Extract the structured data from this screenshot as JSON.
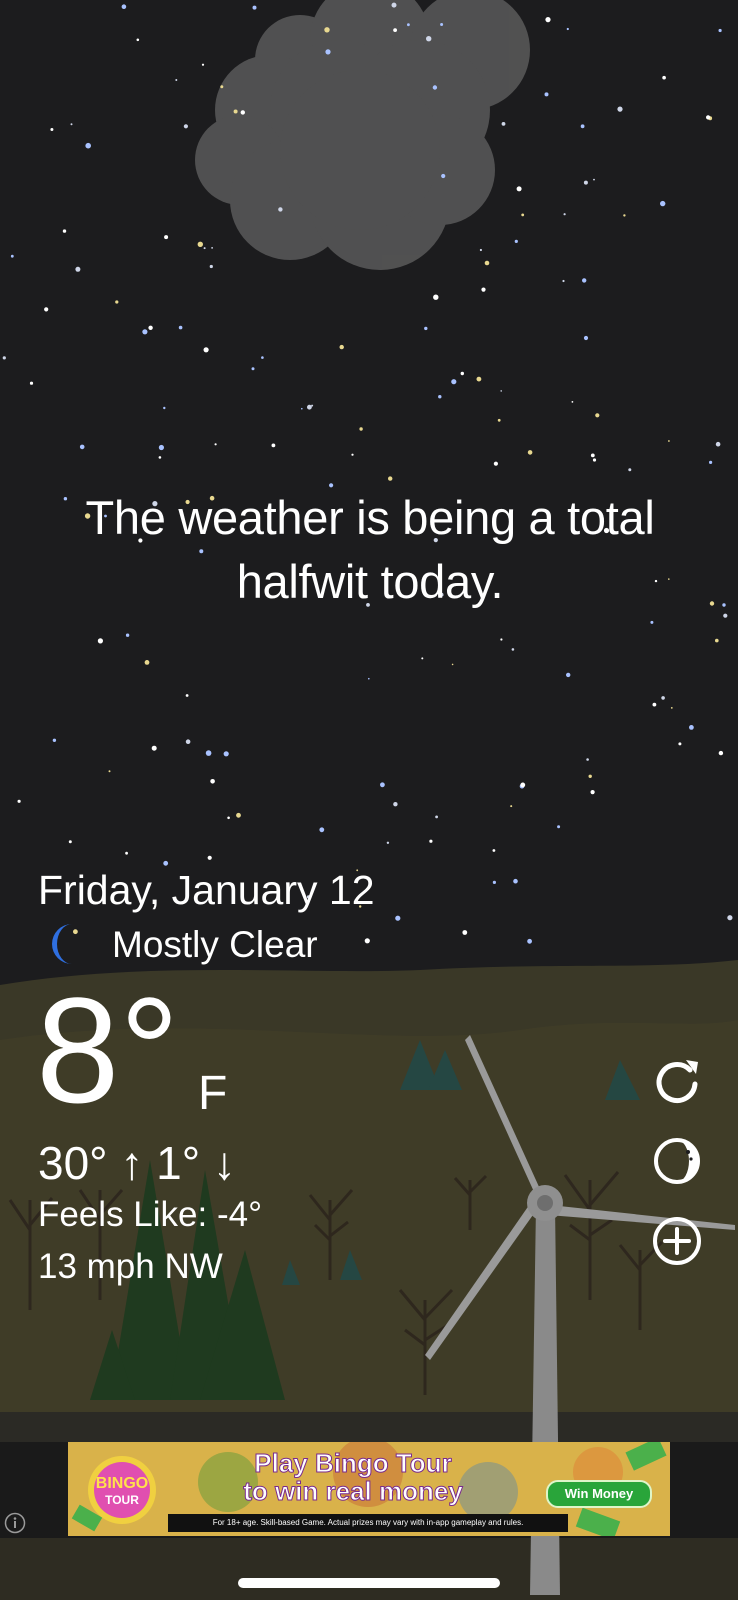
{
  "tagline": {
    "line1": "The weather is being a total",
    "line2": "halfwit today."
  },
  "current": {
    "date": "Friday, January 12",
    "condition": "Mostly Clear",
    "condition_icon": "crescent-moon-icon",
    "temperature": "8°",
    "unit": "F",
    "high_low": "30° ↑  1° ↓",
    "feels_like": "Feels Like: -4°",
    "wind": "13 mph NW"
  },
  "actions": {
    "refresh_icon": "refresh-icon",
    "moon_phase_icon": "moon-phase-icon",
    "add_location_icon": "plus-circle-icon"
  },
  "ad": {
    "logo_line1": "BINGO",
    "logo_line2": "TOUR",
    "headline_line1": "Play Bingo Tour",
    "headline_line2": "to win real money",
    "cta": "Win Money",
    "disclaimer": "For 18+ age. Skill-based Game. Actual prizes may vary with in-app gameplay and rules.",
    "info_icon": "info-icon"
  },
  "colors": {
    "sky": "#1c1c1e",
    "hills": "#3b3a2a",
    "moon_icon": "#2f6fe0",
    "text": "#ffffff"
  }
}
